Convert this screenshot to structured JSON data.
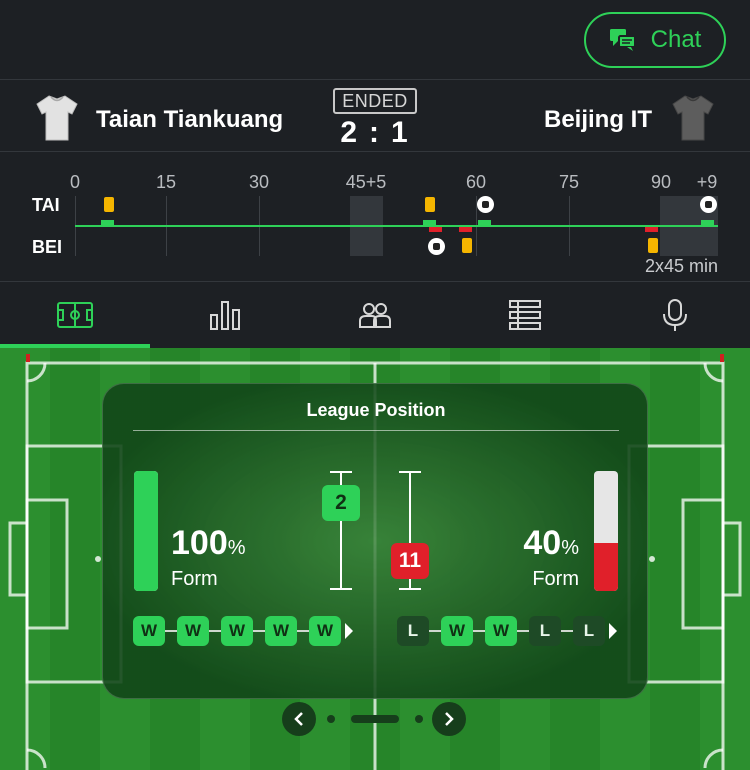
{
  "header": {
    "chat_label": "Chat"
  },
  "match": {
    "status": "ENDED",
    "home": {
      "name": "Taian Tiankuang",
      "short": "TAI",
      "score": "2"
    },
    "away": {
      "name": "Beijing IT",
      "short": "BEI",
      "score": "1"
    },
    "score_separator": ":"
  },
  "timeline": {
    "ticks": [
      "0",
      "15",
      "30",
      "45+5",
      "60",
      "75",
      "90",
      "+9"
    ],
    "duration": "2x45 min"
  },
  "tabs": [
    {
      "icon": "pitch-icon",
      "active": true
    },
    {
      "icon": "stats-icon",
      "active": false
    },
    {
      "icon": "lineups-icon",
      "active": false
    },
    {
      "icon": "table-icon",
      "active": false
    },
    {
      "icon": "commentary-icon",
      "active": false
    }
  ],
  "league_position": {
    "title": "League Position",
    "home": {
      "position": "2",
      "form_pct": "100",
      "form_label": "Form",
      "form_fraction": 1.0,
      "results": [
        "W",
        "W",
        "W",
        "W",
        "W"
      ]
    },
    "away": {
      "position": "11",
      "form_pct": "40",
      "form_label": "Form",
      "form_fraction": 0.4,
      "results": [
        "L",
        "W",
        "W",
        "L",
        "L"
      ]
    },
    "percent_symbol": "%"
  },
  "colors": {
    "accent": "#2ed158",
    "yellow_card": "#f5b500",
    "away_red": "#e0202a",
    "pitch": "#2c8f2f"
  }
}
